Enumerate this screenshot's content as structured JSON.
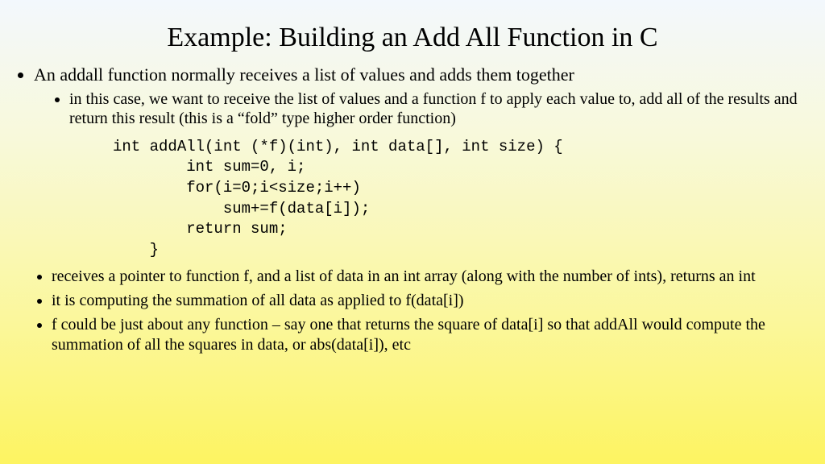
{
  "title": "Example: Building an Add All Function in C",
  "bullet_top": "An addall function normally receives a list of values and adds them together",
  "sub_1": "in this case, we want to receive the list of values and a function f to apply each value to, add all of the results and return this result (this is a “fold” type higher order function)",
  "code": "int addAll(int (*f)(int), int data[], int size) {\n        int sum=0, i;\n        for(i=0;i<size;i++)\n            sum+=f(data[i]);\n        return sum;\n    }",
  "sub_2": "receives a pointer to function f, and a list of data in an int array (along with the number of ints), returns an int",
  "sub_3": "it is computing the summation of all data as applied to f(data[i])",
  "sub_4": "f could be just about any function – say one that returns the square of data[i] so that addAll would compute the summation of all the squares in data, or abs(data[i]), etc"
}
